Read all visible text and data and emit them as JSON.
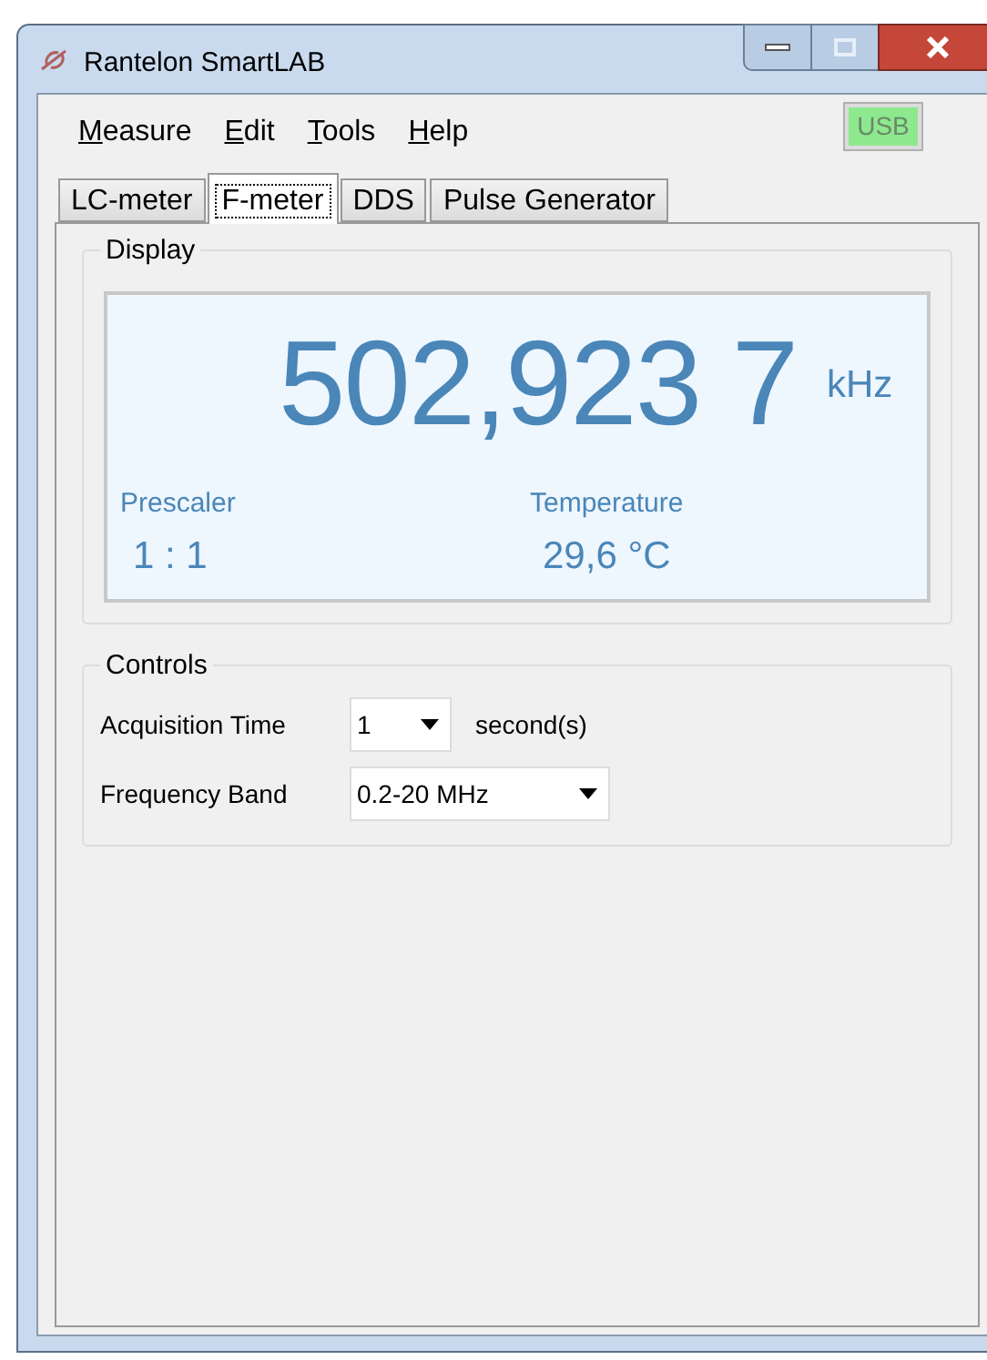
{
  "window": {
    "title": "Rantelon SmartLAB"
  },
  "menu": [
    {
      "label": "Measure"
    },
    {
      "label": "Edit"
    },
    {
      "label": "Tools"
    },
    {
      "label": "Help"
    }
  ],
  "connection": {
    "label": "USB",
    "connected": true
  },
  "tabs": [
    {
      "label": "LC-meter",
      "selected": false
    },
    {
      "label": "F-meter",
      "selected": true
    },
    {
      "label": "DDS",
      "selected": false
    },
    {
      "label": "Pulse Generator",
      "selected": false
    }
  ],
  "display": {
    "title": "Display",
    "frequency": "502,923 7",
    "unit": "kHz",
    "prescaler_label": "Prescaler",
    "prescaler": "1 : 1",
    "temperature_label": "Temperature",
    "temperature": "29,6 °C"
  },
  "controls": {
    "title": "Controls",
    "rows": [
      {
        "label": "Acquisition Time",
        "value": "1",
        "suffix": "second(s)"
      },
      {
        "label": "Frequency Band",
        "value": "0.2-20 MHz"
      }
    ]
  }
}
